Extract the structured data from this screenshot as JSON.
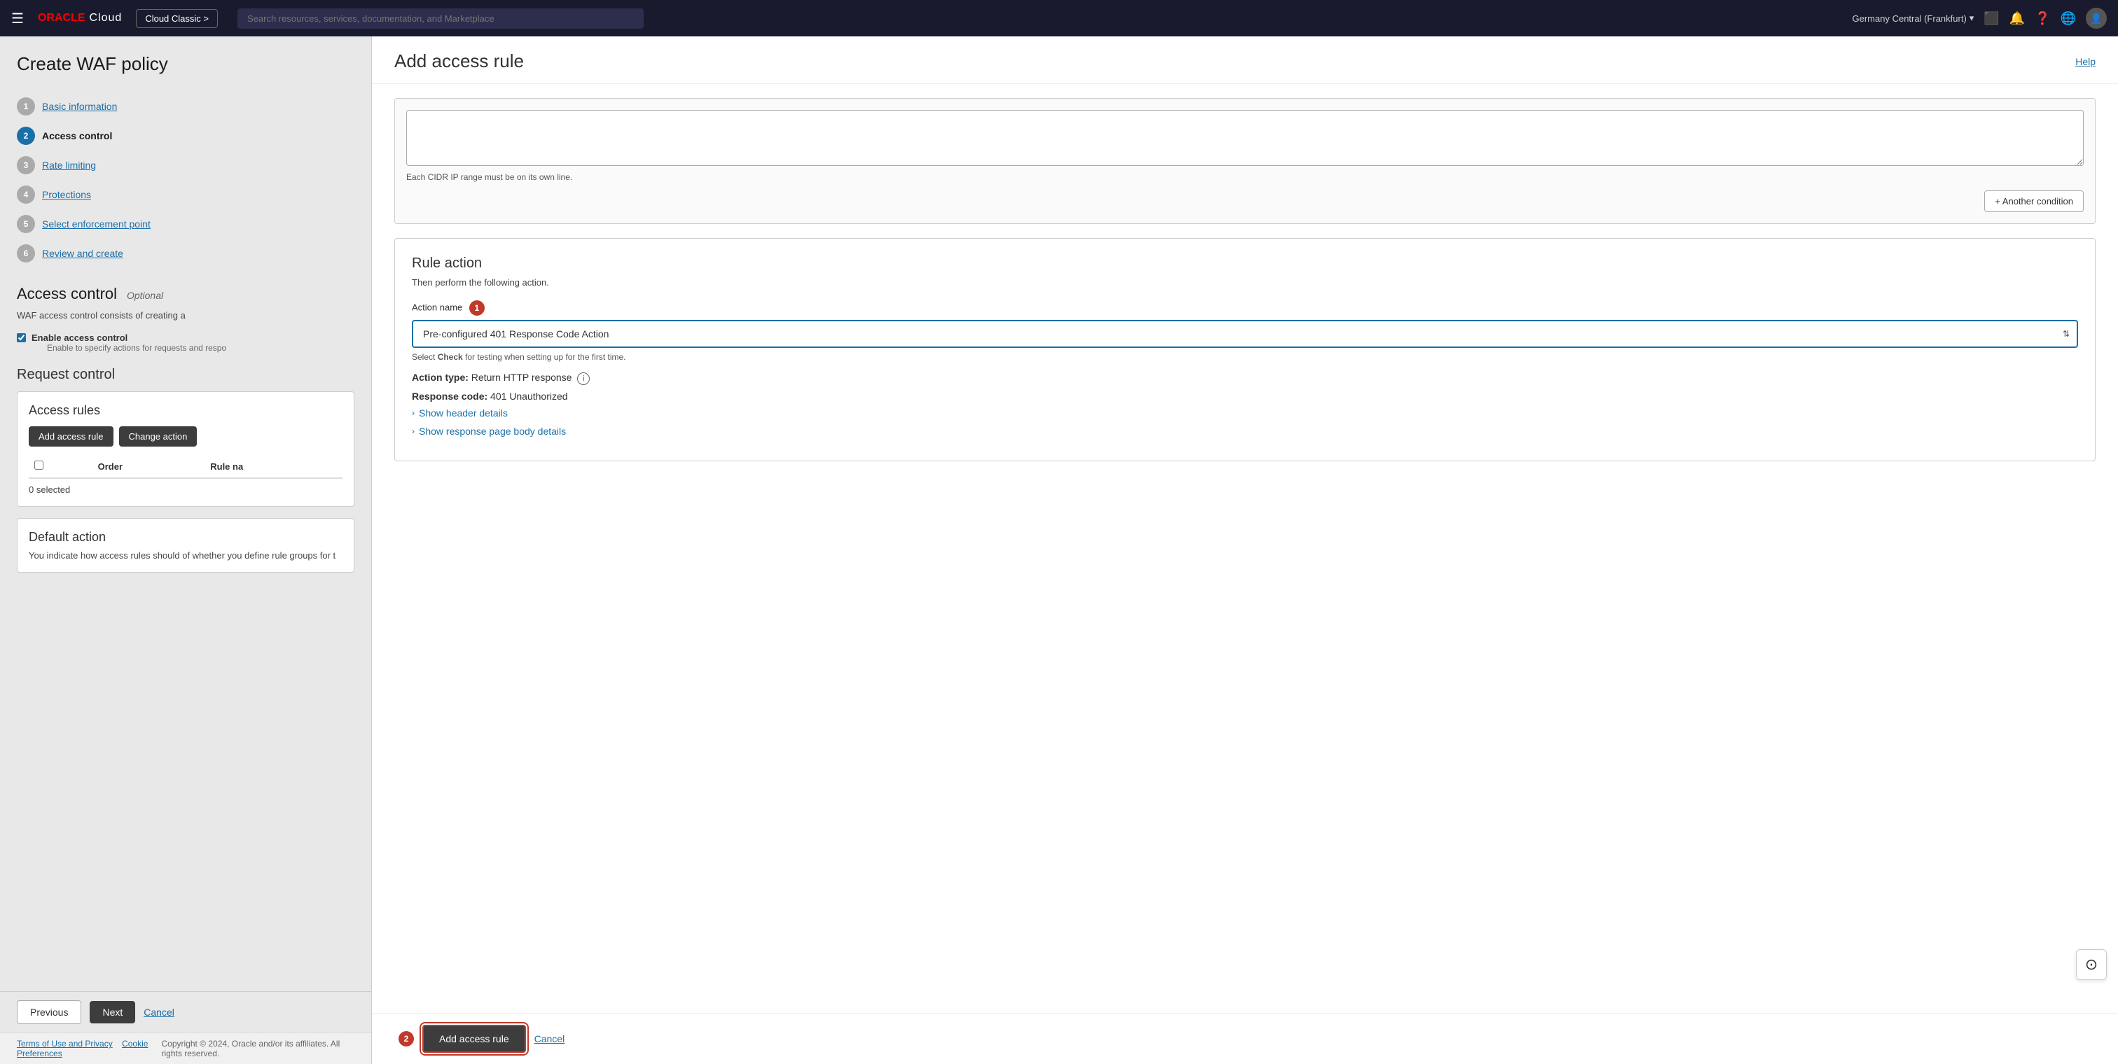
{
  "topnav": {
    "hamburger_icon": "☰",
    "oracle_text": "ORACLE",
    "cloud_text": "Cloud",
    "classic_btn": "Cloud Classic >",
    "search_placeholder": "Search resources, services, documentation, and Marketplace",
    "region": "Germany Central (Frankfurt)",
    "region_icon": "▾",
    "icons": {
      "terminal": "⬜",
      "bell": "🔔",
      "help": "?",
      "globe": "🌐",
      "user": "👤"
    }
  },
  "leftpanel": {
    "title": "Create WAF policy",
    "steps": [
      {
        "number": "1",
        "label": "Basic information",
        "state": "inactive"
      },
      {
        "number": "2",
        "label": "Access control",
        "state": "active"
      },
      {
        "number": "3",
        "label": "Rate limiting",
        "state": "inactive"
      },
      {
        "number": "4",
        "label": "Protections",
        "state": "inactive"
      },
      {
        "number": "5",
        "label": "Select enforcement point",
        "state": "inactive"
      },
      {
        "number": "6",
        "label": "Review and create",
        "state": "inactive"
      }
    ],
    "access_control": {
      "heading": "Access control",
      "optional": "Optional",
      "description": "WAF access control consists of creating a",
      "enable_label": "Enable access control",
      "enable_sub": "Enable to specify actions for requests and respo"
    },
    "request_control": {
      "heading": "Request control"
    },
    "access_rules": {
      "heading": "Access rules",
      "add_btn": "Add access rule",
      "change_btn": "Change action",
      "table_headers": [
        "Order",
        "Rule na"
      ],
      "selected_count": "0 selected"
    },
    "default_action": {
      "heading": "Default action",
      "description": "You indicate how access rules should of whether you define rule groups for t"
    }
  },
  "footer": {
    "previous": "Previous",
    "next": "Next",
    "cancel": "Cancel"
  },
  "terms": {
    "left_links": [
      "Terms of Use and Privacy",
      "Cookie Preferences"
    ],
    "right_text": "Copyright © 2024, Oracle and/or its affiliates. All rights reserved."
  },
  "drawer": {
    "title": "Add access rule",
    "help_link": "Help",
    "cidr_hint": "Each CIDR IP range must be on its own line.",
    "another_condition_btn": "+ Another condition",
    "rule_action": {
      "heading": "Rule action",
      "description": "Then perform the following action.",
      "field_label": "Action name",
      "badge_1": "1",
      "select_value": "Pre-configured 401 Response Code Action",
      "select_hint_pre": "Select ",
      "select_hint_check": "Check",
      "select_hint_post": " for testing when setting up for the first time.",
      "action_type_label": "Action type:",
      "action_type_value": "Return HTTP response",
      "response_code_label": "Response code:",
      "response_code_value": "401 Unauthorized",
      "show_header_details": "Show header details",
      "show_response_body": "Show response page body details"
    },
    "footer": {
      "badge_2": "2",
      "add_rule_btn": "Add access rule",
      "cancel_btn": "Cancel"
    }
  }
}
